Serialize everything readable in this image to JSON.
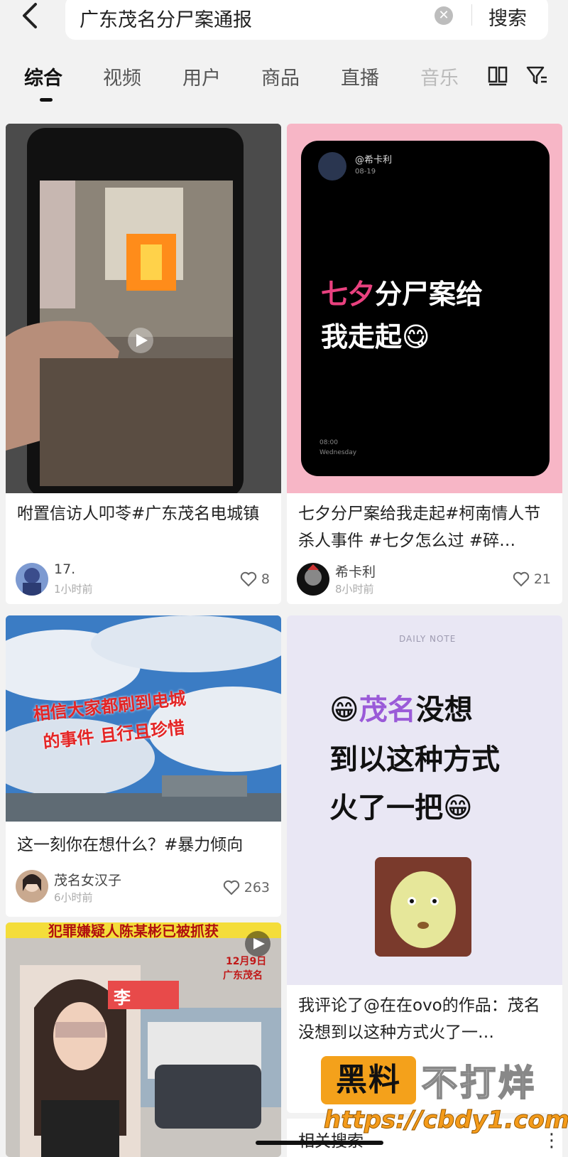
{
  "search": {
    "query": "广东茂名分尸案通报",
    "clear_label": "✕",
    "submit_label": "搜索"
  },
  "tabs": [
    {
      "label": "综合"
    },
    {
      "label": "视频"
    },
    {
      "label": "用户"
    },
    {
      "label": "商品"
    },
    {
      "label": "直播"
    },
    {
      "label": "音乐"
    }
  ],
  "cards": [
    {
      "title": "咐置信访人叩苓#广东茂名电城镇",
      "author": "17.",
      "time": "1小时前",
      "likes": "8"
    },
    {
      "image": {
        "handle": "@希卡利",
        "date": "08-19",
        "headline_highlight": "七夕",
        "headline_rest": "分尸案给",
        "headline_line2": "我走起",
        "emoji": "😋",
        "clock": "08:00",
        "weekday": "Wednesday"
      },
      "title": "七夕分尸案给我走起#柯南情人节杀人事件 #七夕怎么过 #碎…",
      "author": "希卡利",
      "time": "8小时前",
      "likes": "21"
    },
    {
      "image": {
        "caption_line1": "相信大家都刷到电城",
        "caption_line2": "的事件 且行且珍惜"
      },
      "title": "这一刻你在想什么？#暴力倾向",
      "author": "茂名女汉子",
      "time": "6小时前",
      "likes": "263"
    },
    {
      "image": {
        "label": "DAILY NOTE",
        "line1_highlight": "茂名",
        "line1_rest": "没想",
        "line2": "到以这种方式",
        "line3": "火了一把",
        "emoji": "😁"
      },
      "title": "我评论了@在在ovo的作品：茂名没想到以这种方式火了一…"
    },
    {
      "image": {
        "banner": "犯罪嫌疑人陈某彬已被抓获",
        "date": "12月9日",
        "place": "广东茂名",
        "name_tag": "李"
      },
      "title": "相关搜索"
    }
  ],
  "watermark": {
    "badge": "黑料",
    "text": "不打烊",
    "url": "https://cbdy1.com"
  },
  "colors": {
    "accent_pink": "#e9417f",
    "card_pink_bg": "#f7b6c6",
    "watermark_orange": "#f4a11b"
  }
}
